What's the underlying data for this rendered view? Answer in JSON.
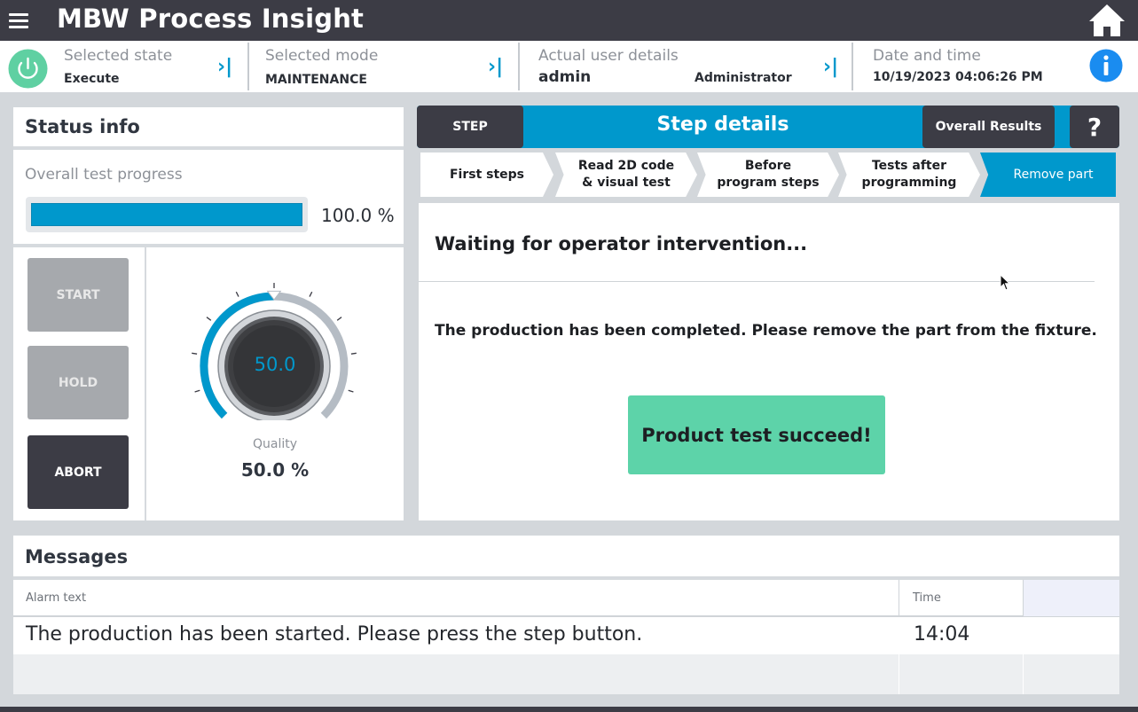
{
  "header": {
    "title": "MBW Process Insight",
    "menu_icon": "menu-icon",
    "home_icon": "home-icon"
  },
  "info_bar": {
    "state_label": "Selected state",
    "state_value": "Execute",
    "mode_label": "Selected mode",
    "mode_value": "MAINTENANCE",
    "user_label": "Actual user details",
    "user_name": "admin",
    "user_role": "Administrator",
    "datetime_label": "Date and time",
    "datetime_value": "10/19/2023 04:06:26 PM",
    "chevron_glyph": "›|"
  },
  "status_info": {
    "title": "Status info",
    "progress_label": "Overall test progress",
    "progress_text": "100.0 %",
    "progress_fraction": 1.0,
    "buttons": {
      "start": "START",
      "hold": "HOLD",
      "abort": "ABORT"
    },
    "gauge": {
      "value_text": "50.0",
      "label": "Quality",
      "percent_text": "50.0 %",
      "fraction": 0.5
    }
  },
  "step_header": {
    "step_button": "STEP",
    "title": "Step details",
    "overall_button": "Overall Results",
    "help_button": "?"
  },
  "steps": [
    {
      "label": "First steps",
      "active": false
    },
    {
      "label": "Read 2D code & visual test",
      "active": false
    },
    {
      "label": "Before program steps",
      "active": false
    },
    {
      "label": "Tests after programming",
      "active": false
    },
    {
      "label": "Remove part",
      "active": true
    }
  ],
  "step_content": {
    "heading": "Waiting for operator intervention...",
    "message": "The production has been completed. Please remove the part from the fixture.",
    "result_button": "Product test succeed!"
  },
  "messages": {
    "title": "Messages",
    "columns": {
      "alarm": "Alarm text",
      "time": "Time"
    },
    "rows": [
      {
        "alarm": "The production has been started. Please press the step button.",
        "time": "14:04"
      }
    ]
  },
  "colors": {
    "accent": "#0098cc",
    "dark": "#3c3c45",
    "success": "#5dd3a9",
    "power": "#5fd0a2"
  }
}
